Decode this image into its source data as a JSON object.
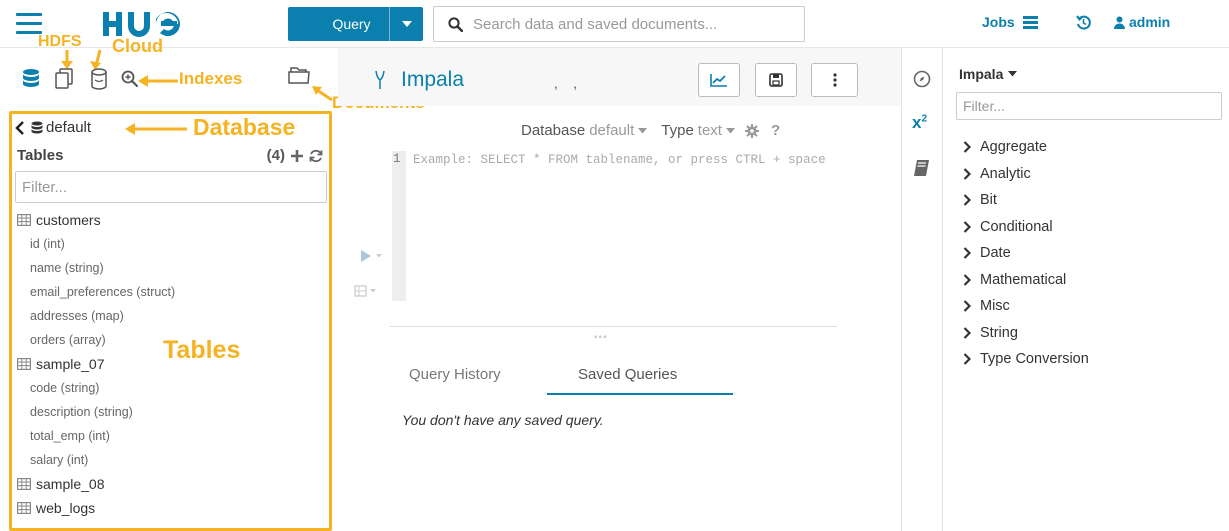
{
  "topbar": {
    "logo_text": "HUE",
    "query_button_label": "Query",
    "search_placeholder": "Search data and saved documents...",
    "jobs_label": "Jobs",
    "user_label": "admin"
  },
  "annotations": {
    "hdfs": "HDFS",
    "cloud": "Cloud",
    "indexes": "Indexes",
    "documents": "Documents",
    "database": "Database",
    "tables": "Tables"
  },
  "assist": {
    "database": "default",
    "tables_header": "Tables",
    "tables_count": "(4)",
    "filter_placeholder": "Filter...",
    "tables": [
      {
        "name": "customers",
        "columns": [
          "id (int)",
          "name (string)",
          "email_preferences (struct)",
          "addresses (map)",
          "orders (array)"
        ]
      },
      {
        "name": "sample_07",
        "columns": [
          "code (string)",
          "description (string)",
          "total_emp (int)",
          "salary (int)"
        ]
      },
      {
        "name": "sample_08",
        "columns": []
      },
      {
        "name": "web_logs",
        "columns": []
      }
    ]
  },
  "editor": {
    "title": "Impala",
    "database_label": "Database",
    "database_value": "default",
    "type_label": "Type",
    "type_value": "text",
    "help_label": "?",
    "line_number": "1",
    "placeholder": "Example: SELECT * FROM tablename, or press CTRL + space",
    "tabs": [
      "Query History",
      "Saved Queries"
    ],
    "active_tab": "Saved Queries",
    "empty_message": "You don't have any saved query."
  },
  "functions": {
    "title": "Impala",
    "filter_placeholder": "Filter...",
    "categories": [
      "Aggregate",
      "Analytic",
      "Bit",
      "Conditional",
      "Date",
      "Mathematical",
      "Misc",
      "String",
      "Type Conversion"
    ]
  },
  "colors": {
    "accent": "#0B7FAD",
    "annotation": "#F5B323"
  }
}
